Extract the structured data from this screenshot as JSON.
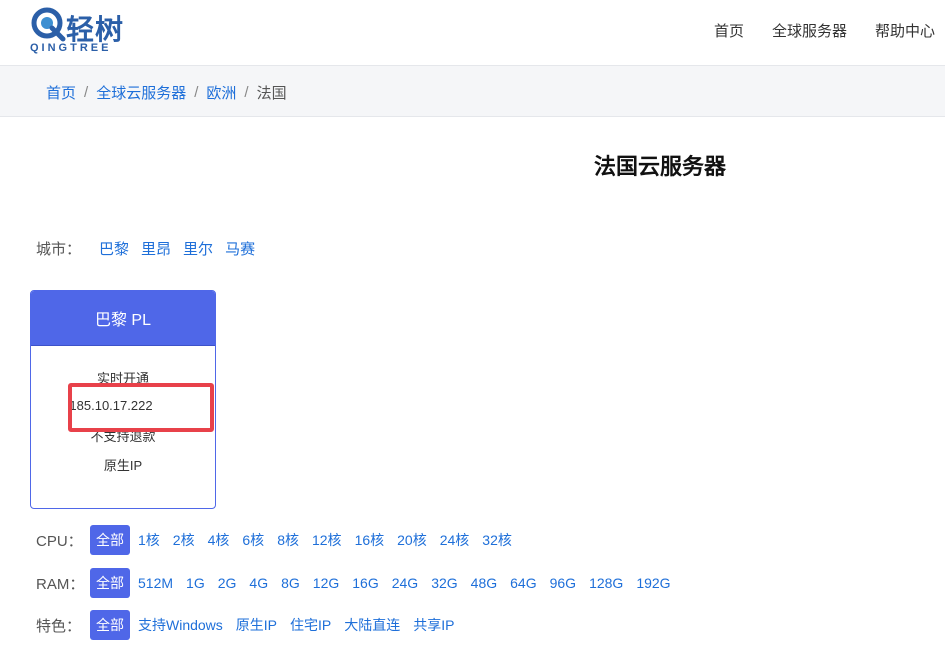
{
  "header": {
    "logo_cn": "轻树",
    "logo_en": "QINGTREE",
    "nav": [
      "首页",
      "全球服务器",
      "帮助中心"
    ]
  },
  "breadcrumb": {
    "items": [
      "首页",
      "全球云服务器",
      "欧洲"
    ],
    "current": "法国",
    "separator": "/"
  },
  "page_title": "法国云服务器",
  "cities": {
    "label": "城市：",
    "items": [
      "巴黎",
      "里昂",
      "里尔",
      "马赛"
    ]
  },
  "card": {
    "title": "巴黎 PL",
    "lines": [
      "实时开通",
      "185.10.17.222",
      "不支持退款",
      "原生IP"
    ]
  },
  "filters": {
    "cpu": {
      "label": "CPU：",
      "all": "全部",
      "options": [
        "1核",
        "2核",
        "4核",
        "6核",
        "8核",
        "12核",
        "16核",
        "20核",
        "24核",
        "32核"
      ]
    },
    "ram": {
      "label": "RAM：",
      "all": "全部",
      "options": [
        "512M",
        "1G",
        "2G",
        "4G",
        "8G",
        "12G",
        "16G",
        "24G",
        "32G",
        "48G",
        "64G",
        "96G",
        "128G",
        "192G"
      ]
    },
    "features": {
      "label": "特色：",
      "all": "全部",
      "options": [
        "支持Windows",
        "原生IP",
        "住宅IP",
        "大陆直连",
        "共享IP"
      ]
    }
  },
  "colors": {
    "accent": "#4f67e8",
    "link": "#1e6fd9",
    "highlight": "#e8414a"
  }
}
